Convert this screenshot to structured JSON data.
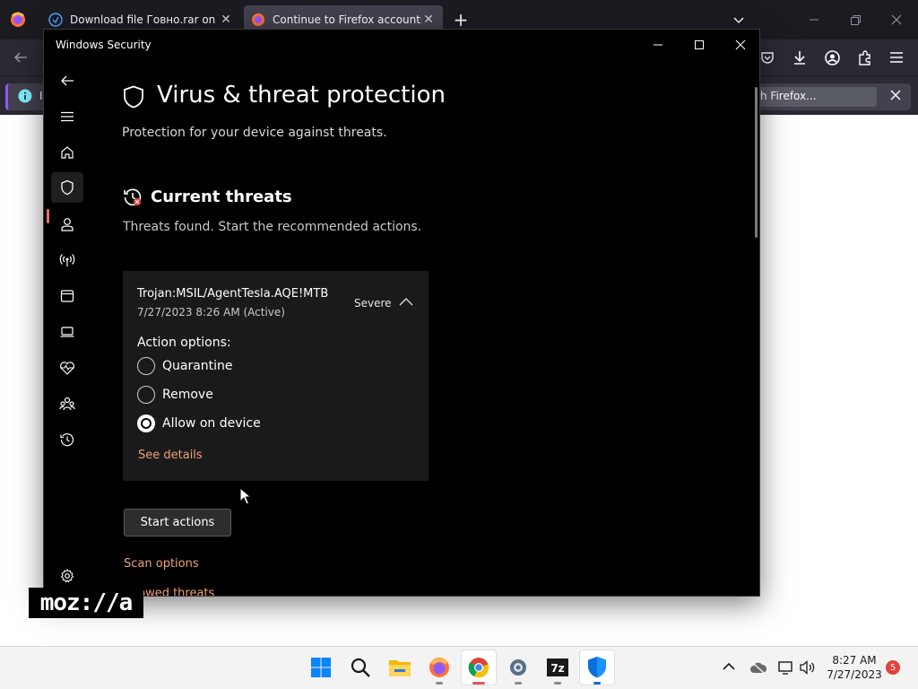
{
  "firefox": {
    "tabs": [
      {
        "title": "Download file Говно.rar on Ox",
        "icon": "download-site-icon"
      },
      {
        "title": "Continue to Firefox accounts",
        "icon": "firefox-accounts-icon"
      }
    ],
    "notification": {
      "text_left": "I",
      "text_right": "h Firefox...",
      "icon": "info-icon"
    },
    "logo_text": "moz://a"
  },
  "window": {
    "title": "Windows Security",
    "controls": [
      "minimize-icon",
      "maximize-icon",
      "close-icon"
    ]
  },
  "sidebar": {
    "items": [
      {
        "icon": "back-arrow-icon"
      },
      {
        "icon": "hamburger-menu-icon"
      },
      {
        "icon": "home-icon"
      },
      {
        "icon": "shield-icon",
        "active": true
      },
      {
        "icon": "account-person-icon"
      },
      {
        "icon": "firewall-network-icon"
      },
      {
        "icon": "app-browser-control-icon"
      },
      {
        "icon": "device-security-icon"
      },
      {
        "icon": "device-health-icon"
      },
      {
        "icon": "family-options-icon"
      },
      {
        "icon": "protection-history-icon"
      },
      {
        "icon": "settings-gear-icon"
      }
    ]
  },
  "main": {
    "title": "Virus & threat protection",
    "subtitle": "Protection for your device against threats.",
    "section_title": "Current threats",
    "section_desc": "Threats found. Start the recommended actions.",
    "threat": {
      "name": "Trojan:MSIL/AgentTesla.AQE!MTB",
      "date": "7/27/2023 8:26 AM (Active)",
      "severity": "Severe",
      "action_label": "Action options:",
      "options": [
        {
          "label": "Quarantine",
          "selected": false
        },
        {
          "label": "Remove",
          "selected": false
        },
        {
          "label": "Allow on device",
          "selected": true
        }
      ],
      "details_link": "See details"
    },
    "start_button": "Start actions",
    "links": [
      "Scan options",
      "Allowed threats"
    ]
  },
  "taskbar": {
    "apps": [
      "windows-start-icon",
      "search-icon",
      "file-explorer-icon",
      "firefox-icon",
      "chrome-icon",
      "settings-icon",
      "7zip-icon",
      "windows-security-icon"
    ],
    "time": "8:27 AM",
    "date": "7/27/2023",
    "notification_count": "5"
  },
  "colors": {
    "accent_link": "#f0a07a",
    "active_indicator": "#e86a6a",
    "window_bg": "#000000",
    "card_bg": "#1a1a1a"
  }
}
